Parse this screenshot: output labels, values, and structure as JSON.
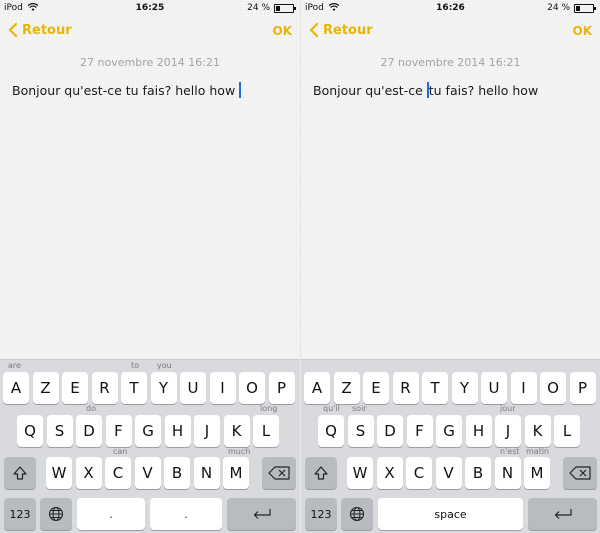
{
  "screens": [
    {
      "status": {
        "carrier": "iPod",
        "time": "16:25",
        "battery": "24 %",
        "battery_level": 0.24
      },
      "nav": {
        "back_label": "Retour",
        "done_label": "OK"
      },
      "note": {
        "date": "27 novembre 2014 16:21",
        "text_before": "Bonjour qu'est-ce tu fais?  hello how ",
        "text_after": ""
      },
      "keyboard": {
        "row1": [
          "A",
          "Z",
          "E",
          "R",
          "T",
          "Y",
          "U",
          "I",
          "O",
          "P"
        ],
        "row2": [
          "Q",
          "S",
          "D",
          "F",
          "G",
          "H",
          "J",
          "K",
          "L"
        ],
        "row3": [
          "W",
          "X",
          "C",
          "V",
          "B",
          "N",
          "M"
        ],
        "suggestions": {
          "are": "are",
          "to": "to",
          "you": "you",
          "do": "do",
          "long": "long",
          "can": "can",
          "much": "much"
        },
        "numbers_label": "123",
        "space_label": "."
      }
    },
    {
      "status": {
        "carrier": "iPod",
        "time": "16:26",
        "battery": "24 %",
        "battery_level": 0.24
      },
      "nav": {
        "back_label": "Retour",
        "done_label": "OK"
      },
      "note": {
        "date": "27 novembre 2014 16:21",
        "text_before": "Bonjour qu'est-ce ",
        "text_after": "tu fais?  hello how"
      },
      "keyboard": {
        "row1": [
          "A",
          "Z",
          "E",
          "R",
          "T",
          "Y",
          "U",
          "I",
          "O",
          "P"
        ],
        "row2": [
          "Q",
          "S",
          "D",
          "F",
          "G",
          "H",
          "J",
          "K",
          "L"
        ],
        "row3": [
          "W",
          "X",
          "C",
          "V",
          "B",
          "N",
          "M"
        ],
        "suggestions": {
          "quil": "qu'il",
          "soir": "soir",
          "jour": "jour",
          "nest": "n'est",
          "matin": "matin"
        },
        "numbers_label": "123",
        "space_label": "space"
      }
    }
  ],
  "icons": [
    "wifi-icon",
    "battery-icon",
    "back-chevron-icon",
    "globe-icon",
    "shift-icon",
    "delete-icon",
    "return-icon"
  ],
  "colors": {
    "accent": "#e8b50b",
    "cursor": "#1f6ce0",
    "keyboard_bg": "#d8dadd"
  }
}
